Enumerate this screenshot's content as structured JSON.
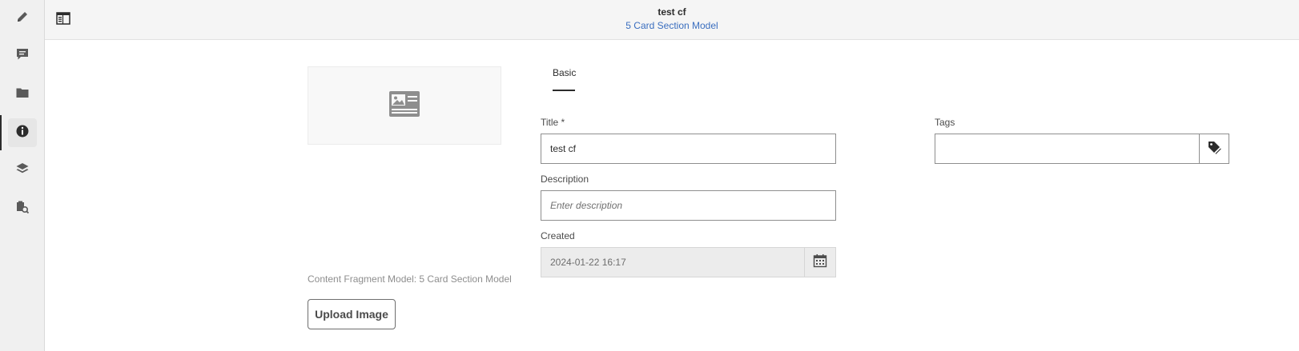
{
  "rail": {
    "items": [
      {
        "name": "edit",
        "icon": "pencil-icon"
      },
      {
        "name": "comments",
        "icon": "comment-icon"
      },
      {
        "name": "assets",
        "icon": "folder-icon"
      },
      {
        "name": "properties",
        "icon": "info-icon",
        "active": true
      },
      {
        "name": "variations",
        "icon": "layers-icon"
      },
      {
        "name": "references",
        "icon": "references-search-icon"
      }
    ]
  },
  "header": {
    "title": "test cf",
    "subtitle": "5 Card Section Model",
    "panel_toggle_icon": "panel-toggle-icon"
  },
  "left": {
    "thumbnail_icon": "image-card-icon",
    "model_label": "Content Fragment Model: 5 Card Section Model",
    "upload_label": "Upload Image"
  },
  "tabs": [
    {
      "label": "Basic",
      "active": true
    }
  ],
  "form": {
    "title_label": "Title *",
    "title_value": "test cf",
    "description_label": "Description",
    "description_placeholder": "Enter description",
    "created_label": "Created",
    "created_value": "2024-01-22 16:17",
    "calendar_icon": "calendar-icon",
    "tags_label": "Tags",
    "tags_value": "",
    "tags_icon": "tag-picker-icon"
  },
  "colors": {
    "link": "#3a6ebf",
    "rail_bg": "#f0f0f0",
    "header_bg": "#f5f5f5"
  }
}
